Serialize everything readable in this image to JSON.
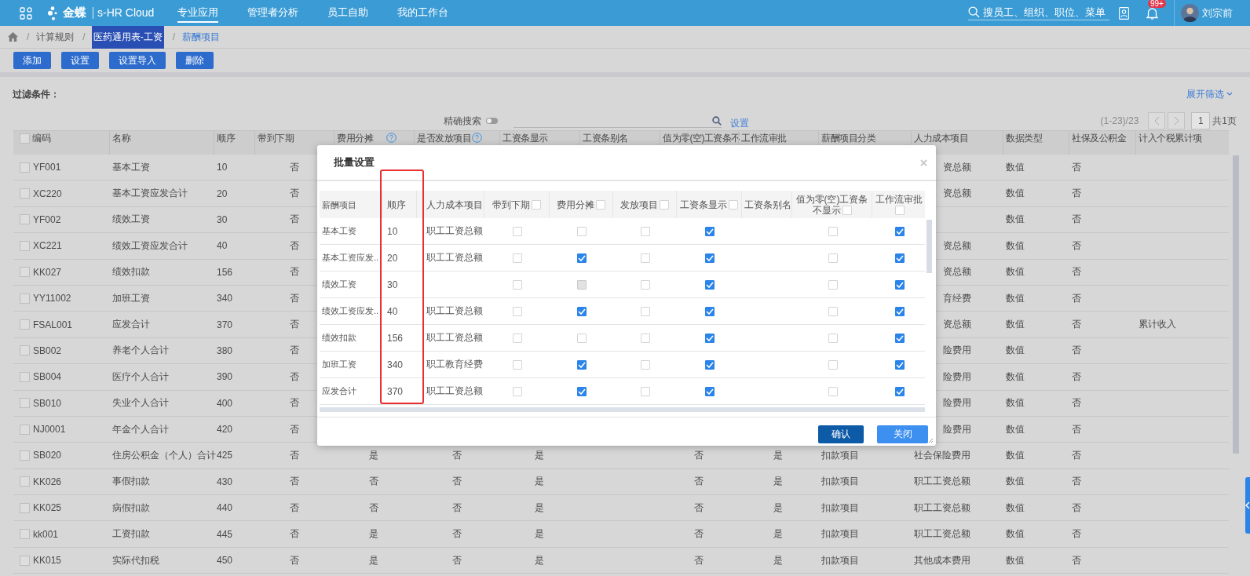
{
  "topbar": {
    "brand": "金蝶",
    "product": "s-HR Cloud",
    "nav": [
      {
        "label": "专业应用",
        "selected": true
      },
      {
        "label": "管理者分析",
        "selected": false
      },
      {
        "label": "员工自助",
        "selected": false
      },
      {
        "label": "我的工作台",
        "selected": false
      }
    ],
    "search": {
      "placeholder": "搜员工、组织、职位、菜单"
    },
    "badge": "99+",
    "user": "刘宗前"
  },
  "breadcrumb": [
    {
      "label": "/",
      "kind": "separator"
    },
    {
      "label": "计算规则",
      "kind": "link"
    },
    {
      "label": "/",
      "kind": "separator"
    },
    {
      "label": "医药通用表-工资",
      "kind": "highlighted"
    },
    {
      "label": "/",
      "kind": "separator"
    },
    {
      "label": "薪酬项目",
      "kind": "current"
    }
  ],
  "actions": [
    "添加",
    "设置",
    "设置导入",
    "删除"
  ],
  "filter": {
    "label": "过滤条件：",
    "expand": "展开筛选"
  },
  "search": {
    "exact_label": "精确搜索",
    "exact_on": false,
    "settings": "设置"
  },
  "pager": {
    "range": "(1-23)/23",
    "page": "1",
    "total": "共1页"
  },
  "table": {
    "select_all": false,
    "columns": [
      {
        "label": "编码",
        "help": false
      },
      {
        "label": "名称",
        "help": false
      },
      {
        "label": "顺序",
        "help": false
      },
      {
        "label": "带到下期",
        "help": false
      },
      {
        "label": "费用分摊",
        "help": true
      },
      {
        "label": "是否发放项目",
        "help": true
      },
      {
        "label": "工资条显示",
        "help": false
      },
      {
        "label": "工资条别名",
        "help": false
      },
      {
        "label": "值为零(空)工资条不",
        "help": false
      },
      {
        "label": "工作流审批",
        "help": false
      },
      {
        "label": "薪酬项目分类",
        "help": false
      },
      {
        "label": "人力成本项目",
        "help": false
      },
      {
        "label": "数据类型",
        "help": false
      },
      {
        "label": "社保及公积金",
        "help": false
      },
      {
        "label": "计入个税累计项",
        "help": false
      }
    ],
    "rows": [
      {
        "checked": false,
        "cells": [
          "YF001",
          "基本工资",
          "10",
          "否",
          null,
          null,
          null,
          null,
          null,
          null,
          null,
          "资总额",
          "数值",
          "否",
          null
        ]
      },
      {
        "checked": false,
        "cells": [
          "XC220",
          "基本工资应发合计",
          "20",
          "否",
          null,
          null,
          null,
          null,
          null,
          null,
          null,
          "资总额",
          "数值",
          "否",
          null
        ]
      },
      {
        "checked": false,
        "cells": [
          "YF002",
          "绩效工资",
          "30",
          "否",
          null,
          null,
          null,
          null,
          null,
          null,
          null,
          null,
          "数值",
          "否",
          null
        ]
      },
      {
        "checked": false,
        "cells": [
          "XC221",
          "绩效工资应发合计",
          "40",
          "否",
          null,
          null,
          null,
          null,
          null,
          null,
          null,
          "资总额",
          "数值",
          "否",
          null
        ]
      },
      {
        "checked": false,
        "cells": [
          "KK027",
          "绩效扣款",
          "156",
          "否",
          null,
          null,
          null,
          null,
          null,
          null,
          null,
          "资总额",
          "数值",
          "否",
          null
        ]
      },
      {
        "checked": false,
        "cells": [
          "YY11002",
          "加班工资",
          "340",
          "否",
          null,
          null,
          null,
          null,
          null,
          null,
          null,
          "育经费",
          "数值",
          "否",
          null
        ]
      },
      {
        "checked": false,
        "cells": [
          "FSAL001",
          "应发合计",
          "370",
          "否",
          null,
          null,
          null,
          null,
          null,
          null,
          null,
          "资总额",
          "数值",
          "否",
          "累计收入"
        ]
      },
      {
        "checked": false,
        "cells": [
          "SB002",
          "养老个人合计",
          "380",
          "否",
          null,
          null,
          null,
          null,
          null,
          null,
          null,
          "险费用",
          "数值",
          "否",
          null
        ]
      },
      {
        "checked": false,
        "cells": [
          "SB004",
          "医疗个人合计",
          "390",
          "否",
          null,
          null,
          null,
          null,
          null,
          null,
          null,
          "险费用",
          "数值",
          "否",
          null
        ]
      },
      {
        "checked": false,
        "cells": [
          "SB010",
          "失业个人合计",
          "400",
          "否",
          null,
          null,
          null,
          null,
          null,
          null,
          null,
          "险费用",
          "数值",
          "否",
          null
        ]
      },
      {
        "checked": false,
        "cells": [
          "NJ0001",
          "年金个人合计",
          "420",
          "否",
          null,
          null,
          null,
          null,
          null,
          null,
          null,
          "险费用",
          "数值",
          "否",
          null
        ]
      },
      {
        "checked": false,
        "cells": [
          "SB020",
          "住房公积金（个人）合计",
          "425",
          "否",
          "是",
          "否",
          "是",
          null,
          "否",
          "是",
          "扣款项目",
          "社会保险费用",
          "数值",
          "否",
          null
        ]
      },
      {
        "checked": false,
        "cells": [
          "KK026",
          "事假扣款",
          "430",
          "否",
          "否",
          "否",
          "是",
          null,
          "否",
          "是",
          "扣款项目",
          "职工工资总额",
          "数值",
          "否",
          null
        ]
      },
      {
        "checked": false,
        "cells": [
          "KK025",
          "病假扣款",
          "440",
          "否",
          "否",
          "否",
          "是",
          null,
          "否",
          "是",
          "扣款项目",
          "职工工资总额",
          "数值",
          "否",
          null
        ]
      },
      {
        "checked": false,
        "cells": [
          "kk001",
          "工资扣款",
          "445",
          "否",
          "是",
          "否",
          "是",
          null,
          "否",
          "是",
          "扣款项目",
          "职工工资总额",
          "数值",
          "否",
          null
        ]
      },
      {
        "checked": false,
        "cells": [
          "KK015",
          "实际代扣税",
          "450",
          "否",
          "是",
          "否",
          "是",
          null,
          "否",
          "是",
          "扣款项目",
          "其他成本费用",
          "数值",
          "否",
          null
        ]
      }
    ]
  },
  "dialog": {
    "title": "批量设置",
    "columns": [
      {
        "label": "薪酬项目",
        "kind": "text"
      },
      {
        "label": "顺序",
        "kind": "text"
      },
      {
        "label": "人力成本项目",
        "kind": "text"
      },
      {
        "label": "带到下期",
        "kind": "check",
        "checked": false
      },
      {
        "label": "费用分摊",
        "kind": "check",
        "checked": false
      },
      {
        "label": "发放项目",
        "kind": "check",
        "checked": false
      },
      {
        "label": "工资条显示",
        "kind": "check",
        "checked": false
      },
      {
        "label": "工资条别名",
        "kind": "text"
      },
      {
        "label": "值为零(空)工资条不显示",
        "kind": "check",
        "checked": false
      },
      {
        "label": "工作流审批",
        "kind": "check",
        "checked": false
      }
    ],
    "rows": [
      {
        "cells": [
          "基本工资",
          "10",
          "职工工资总额",
          {
            "checked": false,
            "disabled": false
          },
          {
            "checked": false,
            "disabled": false
          },
          {
            "checked": false,
            "disabled": false
          },
          {
            "checked": true,
            "disabled": false
          },
          null,
          {
            "checked": false,
            "disabled": false
          },
          {
            "checked": true,
            "disabled": false
          }
        ]
      },
      {
        "cells": [
          "基本工资应发..",
          "20",
          "职工工资总额",
          {
            "checked": false,
            "disabled": false
          },
          {
            "checked": true,
            "disabled": false
          },
          {
            "checked": false,
            "disabled": false
          },
          {
            "checked": true,
            "disabled": false
          },
          null,
          {
            "checked": false,
            "disabled": false
          },
          {
            "checked": true,
            "disabled": false
          }
        ]
      },
      {
        "cells": [
          "绩效工资",
          "30",
          null,
          {
            "checked": false,
            "disabled": false
          },
          {
            "checked": false,
            "disabled": true
          },
          {
            "checked": false,
            "disabled": false
          },
          {
            "checked": true,
            "disabled": false
          },
          null,
          {
            "checked": false,
            "disabled": false
          },
          {
            "checked": true,
            "disabled": false
          }
        ]
      },
      {
        "cells": [
          "绩效工资应发..",
          "40",
          "职工工资总额",
          {
            "checked": false,
            "disabled": false
          },
          {
            "checked": true,
            "disabled": false
          },
          {
            "checked": false,
            "disabled": false
          },
          {
            "checked": true,
            "disabled": false
          },
          null,
          {
            "checked": false,
            "disabled": false
          },
          {
            "checked": true,
            "disabled": false
          }
        ]
      },
      {
        "cells": [
          "绩效扣款",
          "156",
          "职工工资总额",
          {
            "checked": false,
            "disabled": false
          },
          {
            "checked": false,
            "disabled": false
          },
          {
            "checked": false,
            "disabled": false
          },
          {
            "checked": true,
            "disabled": false
          },
          null,
          {
            "checked": false,
            "disabled": false
          },
          {
            "checked": true,
            "disabled": false
          }
        ]
      },
      {
        "cells": [
          "加班工资",
          "340",
          "职工教育经费",
          {
            "checked": false,
            "disabled": false
          },
          {
            "checked": true,
            "disabled": false
          },
          {
            "checked": false,
            "disabled": false
          },
          {
            "checked": true,
            "disabled": false
          },
          null,
          {
            "checked": false,
            "disabled": false
          },
          {
            "checked": true,
            "disabled": false
          }
        ]
      },
      {
        "cells": [
          "应发合计",
          "370",
          "职工工资总额",
          {
            "checked": false,
            "disabled": false
          },
          {
            "checked": true,
            "disabled": false
          },
          {
            "checked": false,
            "disabled": false
          },
          {
            "checked": true,
            "disabled": false
          },
          null,
          {
            "checked": false,
            "disabled": false
          },
          {
            "checked": true,
            "disabled": false
          }
        ]
      }
    ],
    "confirm": "确认",
    "close": "关闭"
  }
}
